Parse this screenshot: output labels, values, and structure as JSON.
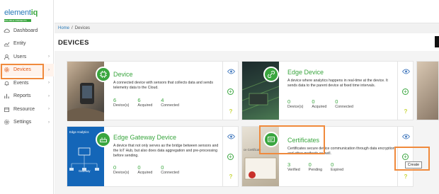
{
  "logo": {
    "brand": "element",
    "brand_suffix": "iq",
    "tagline": "SOLUBLE CONNECTS"
  },
  "sidebar": {
    "items": [
      {
        "label": "Dashboard",
        "icon": "cloud-icon",
        "chevron": ""
      },
      {
        "label": "Entity",
        "icon": "chart-line-icon",
        "chevron": ""
      },
      {
        "label": "Users",
        "icon": "user-icon",
        "chevron": "›"
      },
      {
        "label": "Devices",
        "icon": "gear-icon",
        "chevron": "›"
      },
      {
        "label": "Events",
        "icon": "bell-icon",
        "chevron": "›"
      },
      {
        "label": "Reports",
        "icon": "bar-chart-icon",
        "chevron": "›"
      },
      {
        "label": "Resource",
        "icon": "box-icon",
        "chevron": "›"
      },
      {
        "label": "Settings",
        "icon": "cog-icon",
        "chevron": "›"
      }
    ],
    "active": "Devices"
  },
  "breadcrumb": {
    "home": "Home",
    "sep": "/",
    "current": "Devices"
  },
  "page": {
    "title": "DEVICES"
  },
  "cards": {
    "device": {
      "title": "Device",
      "desc": "A connected device with sensors that collects data and sends telemetry data to the Cloud.",
      "stats": [
        {
          "num": "6",
          "lbl": "Device(s)"
        },
        {
          "num": "6",
          "lbl": "Acquired"
        },
        {
          "num": "4",
          "lbl": "Connected"
        }
      ]
    },
    "edge": {
      "title": "Edge Device",
      "desc": "A device where analytics happens in real-time at the device. It sends data to the parent device at fixed time intervals.",
      "stats": [
        {
          "num": "0",
          "lbl": "Device(s)"
        },
        {
          "num": "0",
          "lbl": "Acquired"
        },
        {
          "num": "0",
          "lbl": "Connected"
        }
      ]
    },
    "gateway": {
      "title": "Edge Gateway Device",
      "thumb_label": "Edge Analytics",
      "thumb_sub": "Gateway",
      "desc": "A device that not only serves as the bridge between sensors and the IoT Hub, but also does data aggregation and pre-processing before sending.",
      "stats": [
        {
          "num": "0",
          "lbl": "Device(s)"
        },
        {
          "num": "0",
          "lbl": "Acquired"
        },
        {
          "num": "0",
          "lbl": "Connected"
        }
      ]
    },
    "certs": {
      "title": "Certificates",
      "thumb_label": "ce Certificate",
      "desc": "Certificates secure device communication through data encryption and other methods as well.",
      "stats": [
        {
          "num": "3",
          "lbl": "Verified"
        },
        {
          "num": "0",
          "lbl": "Pending"
        },
        {
          "num": "0",
          "lbl": "Expired"
        }
      ]
    }
  },
  "tooltip": {
    "create": "Create"
  },
  "colors": {
    "accent_green": "#3aa63f",
    "highlight_orange": "#f08a3c",
    "link_blue": "#2a7ab8"
  }
}
